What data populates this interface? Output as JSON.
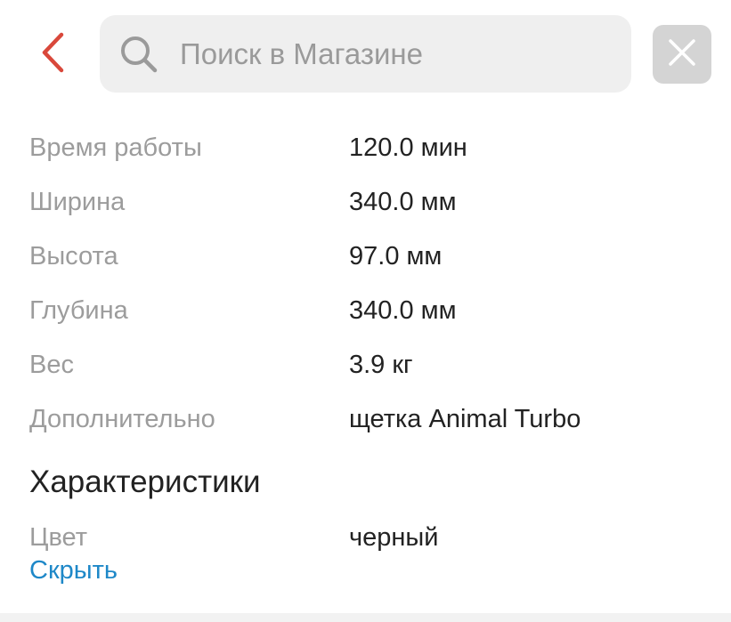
{
  "search": {
    "placeholder": "Поиск в Магазине"
  },
  "icons": {
    "back": "chevron-left-icon",
    "search": "search-icon",
    "clear": "close-icon"
  },
  "colors": {
    "back_chevron": "#d9483b",
    "link": "#1e88c8",
    "label": "#9c9c9c",
    "value": "#222222",
    "search_bg": "#efefef",
    "clear_bg": "#d4d4d4"
  },
  "specs": [
    {
      "label": "Время работы",
      "value": "120.0 мин"
    },
    {
      "label": "Ширина",
      "value": "340.0 мм"
    },
    {
      "label": "Высота",
      "value": "97.0 мм"
    },
    {
      "label": "Глубина",
      "value": "340.0 мм"
    },
    {
      "label": "Вес",
      "value": "3.9 кг"
    },
    {
      "label": "Дополнительно",
      "value": "щетка Animal Turbo"
    }
  ],
  "characteristics": {
    "title": "Характеристики",
    "color_label": "Цвет",
    "color_value": "черный",
    "hide_link": "Скрыть"
  }
}
